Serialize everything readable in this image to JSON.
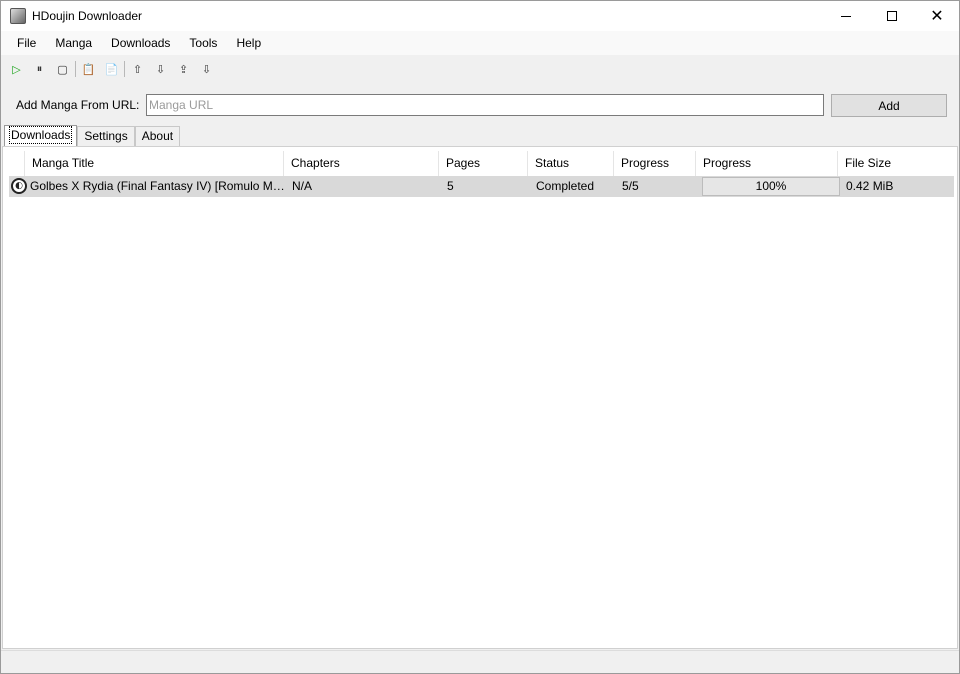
{
  "window": {
    "title": "HDoujin Downloader",
    "minimize_label": "—",
    "close_label": "✕"
  },
  "menu": [
    "File",
    "Manga",
    "Downloads",
    "Tools",
    "Help"
  ],
  "toolbar": {
    "start": "▷",
    "pause": "⏸",
    "stop": "▢",
    "paste": "📋",
    "paste_all": "📄",
    "move_up": "⇧",
    "move_down": "⇩",
    "move_top": "⇪",
    "move_bottom": "⇩"
  },
  "url_bar": {
    "label": "Add Manga From URL:",
    "placeholder": "Manga URL",
    "value": "",
    "add_label": "Add"
  },
  "tabs": [
    {
      "label": "Downloads",
      "active": true
    },
    {
      "label": "Settings",
      "active": false
    },
    {
      "label": "About",
      "active": false
    }
  ],
  "table": {
    "columns": [
      "Manga Title",
      "Chapters",
      "Pages",
      "Status",
      "Progress",
      "Progress",
      "File Size"
    ],
    "rows": [
      {
        "icon": "site-icon",
        "title": "Golbes X Rydia (Final Fantasy IV) [Romulo Melkor Mancin]",
        "chapters": "N/A",
        "pages": "5",
        "status": "Completed",
        "progress_text": "5/5",
        "progress_percent": "100%",
        "progress_fraction": 1.0,
        "file_size": "0.42 MiB"
      }
    ]
  },
  "colors": {
    "selected_row": "#d9d9d9",
    "play_green": "#1aa31a",
    "placeholder": "#9b9b9b"
  }
}
